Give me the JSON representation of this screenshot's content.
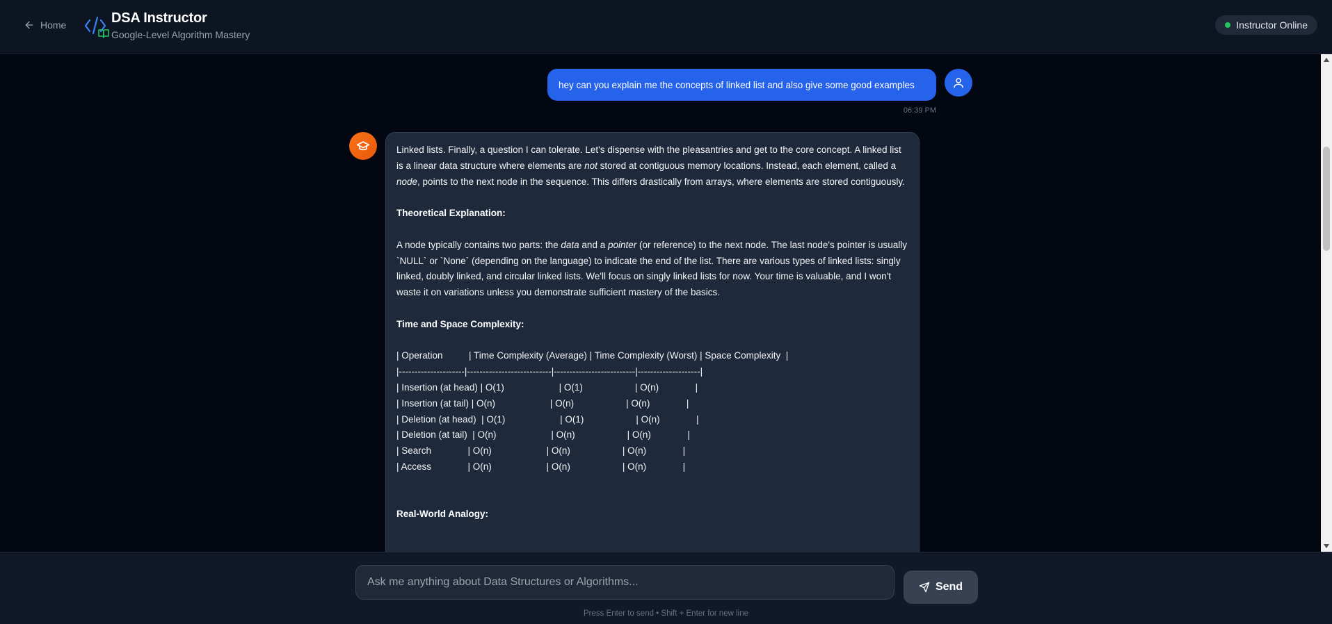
{
  "header": {
    "home_label": "Home",
    "title": "DSA Instructor",
    "subtitle": "Google-Level Algorithm Mastery",
    "status": "Instructor Online",
    "status_color": "#22c55e",
    "accent_color": "#3b82f6"
  },
  "messages": {
    "user": {
      "text": "hey can you explain me the concepts of linked list and also give some good examples",
      "time": "06:39 PM",
      "avatar_icon": "user-icon"
    },
    "bot": {
      "avatar_icon": "graduation-cap-icon",
      "intro": {
        "a": "Linked lists.  Finally, a question I can tolerate. Let's dispense with the pleasantries and get to the core concept.  A linked list is a linear data structure where elements are ",
        "em1": "not",
        "b": " stored at contiguous memory locations. Instead, each element, called a ",
        "em2": "node",
        "c": ", points to the next node in the sequence.  This differs drastically from arrays, where elements are stored contiguously."
      },
      "h_theory": "Theoretical Explanation:",
      "theory": {
        "a": "A node typically contains two parts: the ",
        "em1": "data",
        "b": " and a ",
        "em2": "pointer",
        "c": " (or reference) to the next node.  The last node's pointer is usually `NULL` or `None` (depending on the language) to indicate the end of the list. There are various types of linked lists: singly linked, doubly linked, and circular linked lists. We'll focus on singly linked lists for now. Your time is valuable, and I won't waste it on variations unless you demonstrate sufficient mastery of the basics."
      },
      "h_complexity": "Time and Space Complexity:",
      "table_lines": [
        "| Operation          | Time Complexity (Average) | Time Complexity (Worst) | Space Complexity  |",
        "|---------------------|---------------------------|--------------------------|--------------------|",
        "| Insertion (at head) | O(1)                     | O(1)                    | O(n)              |",
        "| Insertion (at tail) | O(n)                     | O(n)                    | O(n)              |",
        "| Deletion (at head)  | O(1)                     | O(1)                    | O(n)              |",
        "| Deletion (at tail)  | O(n)                     | O(n)                    | O(n)              |",
        "| Search              | O(n)                     | O(n)                    | O(n)              |",
        "| Access              | O(n)                     | O(n)                    | O(n)              |"
      ],
      "h_analogy": "Real-World Analogy:"
    }
  },
  "input": {
    "placeholder": "Ask me anything about Data Structures or Algorithms...",
    "value": "",
    "send_label": "Send",
    "hint": "Press Enter to send • Shift + Enter for new line"
  }
}
